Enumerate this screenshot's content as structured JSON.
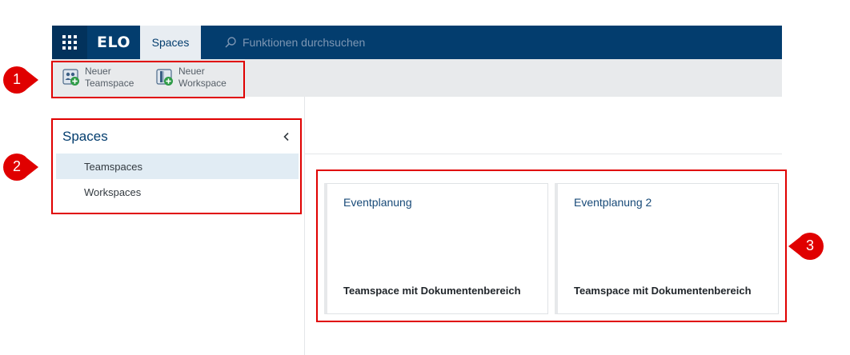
{
  "header": {
    "apps_icon": "grid-icon",
    "logo": "ELO",
    "active_tab": "Spaces",
    "search_placeholder": "Funktionen durchsuchen"
  },
  "toolbar": {
    "new_teamspace": {
      "line1": "Neuer",
      "line2": "Teamspace",
      "icon": "new-teamspace-icon"
    },
    "new_workspace": {
      "line1": "Neuer",
      "line2": "Workspace",
      "icon": "new-workspace-icon"
    }
  },
  "sidebar": {
    "title": "Spaces",
    "collapse_icon": "chevron-left-icon",
    "items": [
      {
        "label": "Teamspaces",
        "active": true
      },
      {
        "label": "Workspaces",
        "active": false
      }
    ]
  },
  "cards": [
    {
      "title": "Eventplanung",
      "subtitle": "Teamspace mit Dokumentenbereich"
    },
    {
      "title": "Eventplanung 2",
      "subtitle": "Teamspace mit Dokumentenbereich"
    }
  ],
  "callouts": [
    "1",
    "2",
    "3"
  ],
  "colors": {
    "header": "#033d6e",
    "callout": "#e00000",
    "active_item": "#e1ecf4"
  }
}
